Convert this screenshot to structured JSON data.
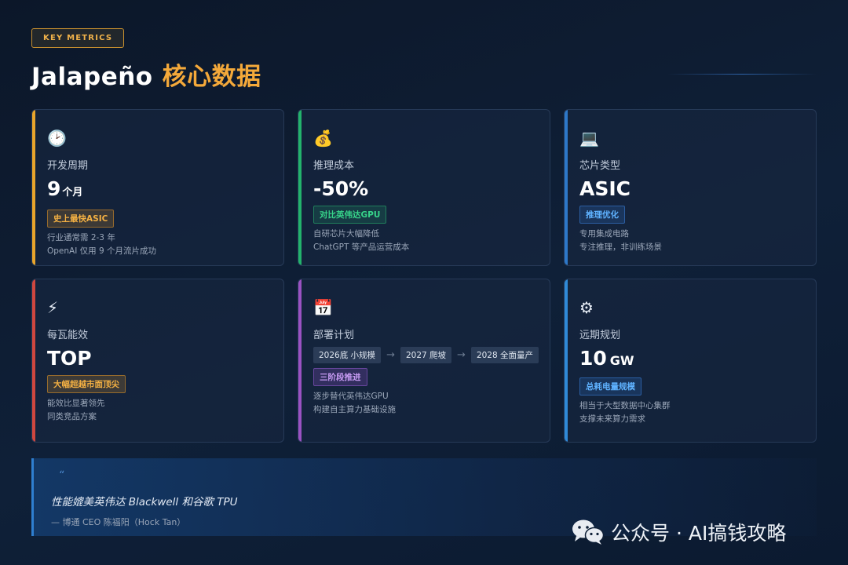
{
  "header": {
    "badge": "KEY METRICS",
    "title_main": "Jalapeño",
    "title_accent": "核心数据"
  },
  "cards": [
    {
      "icon": "clock-icon",
      "glyph": "🕑",
      "accent": "#e9a52b",
      "label": "开发周期",
      "value": "9",
      "unit": "个月",
      "tag": "史上最快ASIC",
      "desc": [
        "行业通常需 2-3 年",
        "OpenAI 仅用 9 个月流片成功"
      ]
    },
    {
      "icon": "money-bag-icon",
      "glyph": "💰",
      "accent": "#23b36c",
      "label": "推理成本",
      "value": "-50%",
      "tag": "对比英伟达GPU",
      "desc": [
        "自研芯片大幅降低",
        "ChatGPT 等产品运营成本"
      ]
    },
    {
      "icon": "laptop-icon",
      "glyph": "💻",
      "accent": "#2d78c9",
      "label": "芯片类型",
      "value": "ASIC",
      "tag": "推理优化",
      "desc": [
        "专用集成电路",
        "专注推理，非训练场景"
      ]
    },
    {
      "icon": "lightning-icon",
      "glyph": "⚡",
      "accent": "#d0473f",
      "label": "每瓦能效",
      "value": "TOP",
      "tag": "大幅超越市面顶尖",
      "desc": [
        "能效比显著领先",
        "同类竞品方案"
      ]
    },
    {
      "icon": "calendar-icon",
      "glyph": "📅",
      "accent": "#9a52c2",
      "label": "部署计划",
      "steps": [
        "2026底 小规模",
        "2027 爬坡",
        "2028 全面量产"
      ],
      "arrow": "→",
      "tag": "三阶段推进",
      "desc": [
        "逐步替代英伟达GPU",
        "构建自主算力基础设施"
      ]
    },
    {
      "icon": "gear-icon",
      "glyph": "⚙",
      "accent": "#2f8ad8",
      "label": "远期规划",
      "value": "10",
      "unit": "GW",
      "tag": "总耗电量规模",
      "desc": [
        "相当于大型数据中心集群",
        "支撑未来算力需求"
      ]
    }
  ],
  "quote": {
    "mark": "“",
    "text": "性能媲美英伟达 Blackwell 和谷歌 TPU",
    "author": "— 博通 CEO 陈福阳（Hock Tan）"
  },
  "watermark": {
    "icon": "wechat-icon",
    "text": "公众号 · AI搞钱攻略"
  },
  "colors": {
    "accent_orange": "#f4a93a",
    "background": "#0f2038"
  }
}
